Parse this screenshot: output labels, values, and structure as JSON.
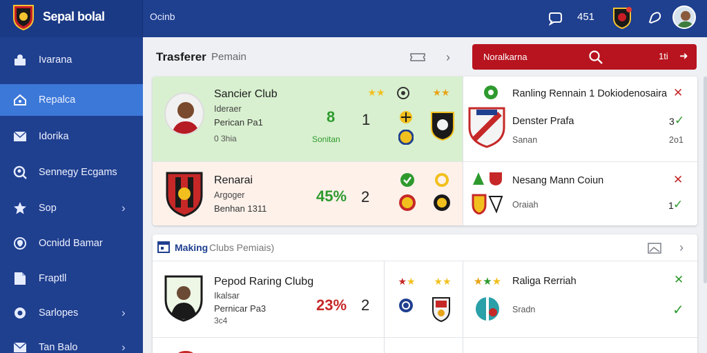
{
  "colors": {
    "brand_blue": "#1f3f8f",
    "active_blue": "#3c78d8",
    "accent_red": "#b7141f",
    "green": "#2e9a2e",
    "green_bg": "#d8f0cf",
    "peach_bg": "#fdf1ea"
  },
  "brand": {
    "title": "Sepal bolal",
    "logo_icon": "club-crest-icon"
  },
  "topbar": {
    "title": "Ocinb",
    "count": "451"
  },
  "sidebar": {
    "items": [
      {
        "label": "Ivarana",
        "icon": "user-icon"
      },
      {
        "label": "Repalca",
        "icon": "home-icon"
      },
      {
        "label": "Idorika",
        "icon": "mail-icon"
      },
      {
        "label": "Sennegy Ecgams",
        "icon": "search-user-icon"
      },
      {
        "label": "Sop",
        "icon": "star-icon"
      },
      {
        "label": "Ocnidd Bamar",
        "icon": "location-icon"
      },
      {
        "label": "Fraptll",
        "icon": "document-icon"
      },
      {
        "label": "Sarlopes",
        "icon": "settings-icon"
      },
      {
        "label": "Tan Balo",
        "icon": "mail-icon"
      }
    ]
  },
  "transfer": {
    "title": "Trasferer",
    "subtitle": "Pemain",
    "search_bar": {
      "label": "Noralkarna",
      "count": "1ti"
    },
    "rows": [
      {
        "name": "Sancier Club",
        "role": "Ideraer",
        "detail": "Perican Pa1",
        "meta": "0 3hia",
        "big_value": "8",
        "big_caption": "Sonitan",
        "rank": "1",
        "right_title": "Ranling Rennain 1 Dokiodenosaira",
        "right_line1": "Denster Prafa",
        "right_line2": "Sanan",
        "right_value1": "3",
        "right_value2": "2o1"
      },
      {
        "name": "Renarai",
        "role": "Argoger",
        "detail": "Benhan 1311",
        "meta": "",
        "big_value": "45%",
        "big_caption": "",
        "rank": "2",
        "right_title": "Nesang Mann Coiun",
        "right_line1": "Oraiah",
        "right_line2": "",
        "right_value1": "1",
        "right_value2": ""
      }
    ]
  },
  "making": {
    "title": "Making",
    "subtitle": "Clubs Pemiais)",
    "rows": [
      {
        "name": "Pepod Raring Clubg",
        "role": "Ikalsar",
        "detail": "Pernicar Pa3",
        "meta": "3c4",
        "big_value": "23%",
        "rank": "2",
        "right_title": "Raliga Rerriah",
        "right_line1": "Sradn"
      }
    ]
  }
}
